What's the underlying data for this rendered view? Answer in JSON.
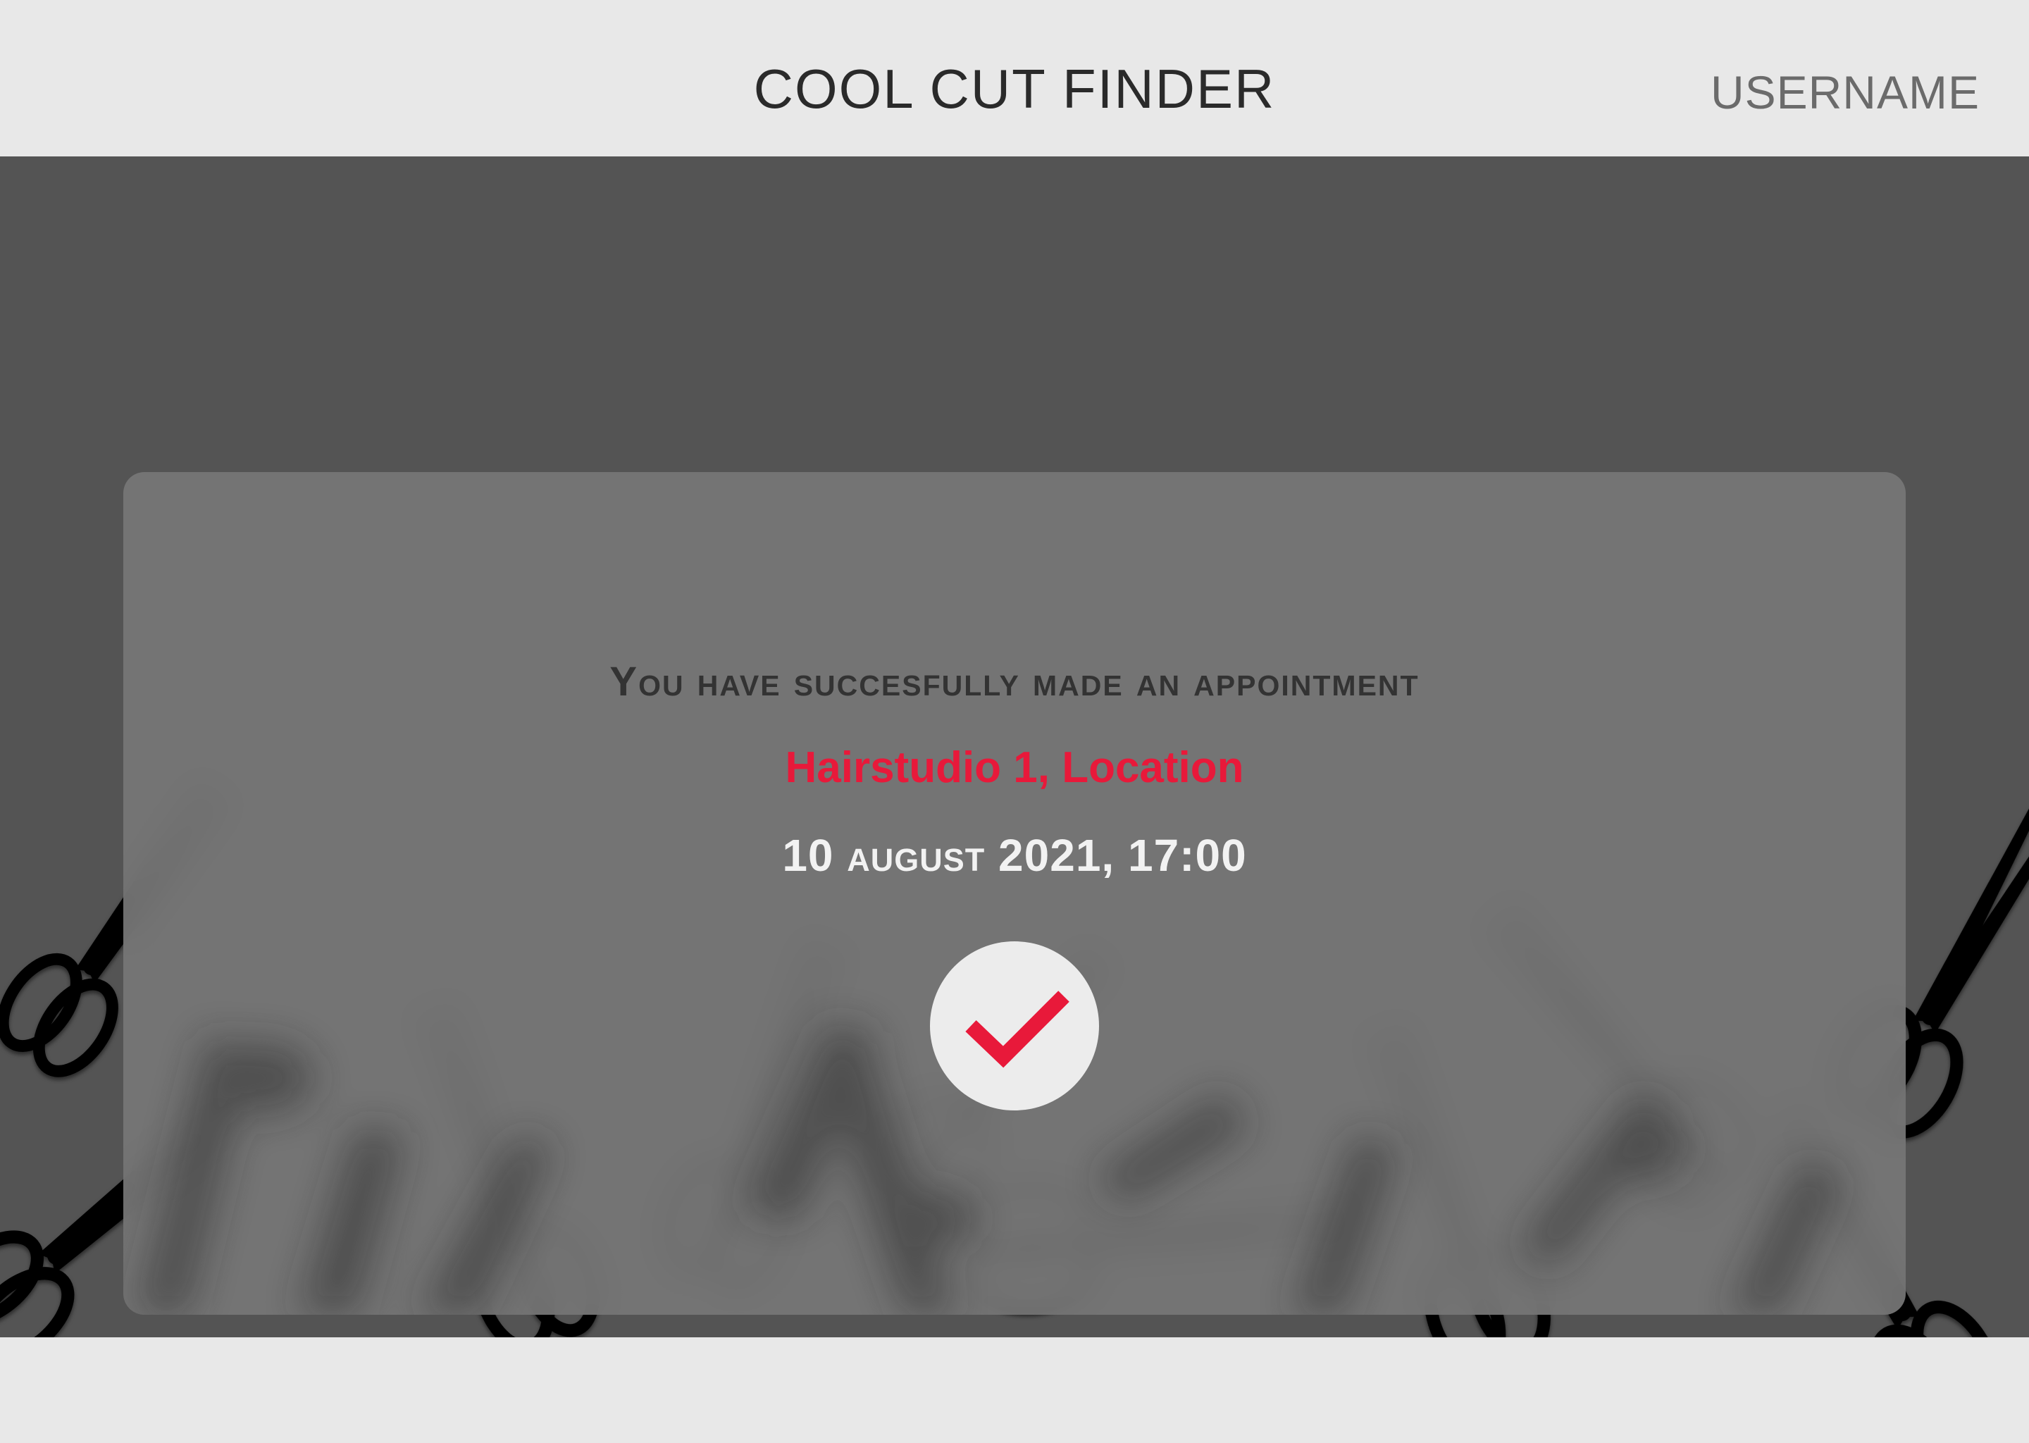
{
  "header": {
    "title": "COOL CUT FINDER",
    "username": "USERNAME"
  },
  "confirmation": {
    "message": "You have succesfully made an appointment",
    "salon": "Hairstudio 1, Location",
    "datetime": "10 august 2021, 17:00",
    "status_icon": "checkmark-icon"
  },
  "colors": {
    "accent": "#e8193a",
    "header_bg": "#e8e8e8",
    "hero_bg": "#545454",
    "card_bg": "#767676"
  },
  "background": {
    "pattern_icon": "scissors-icon"
  }
}
